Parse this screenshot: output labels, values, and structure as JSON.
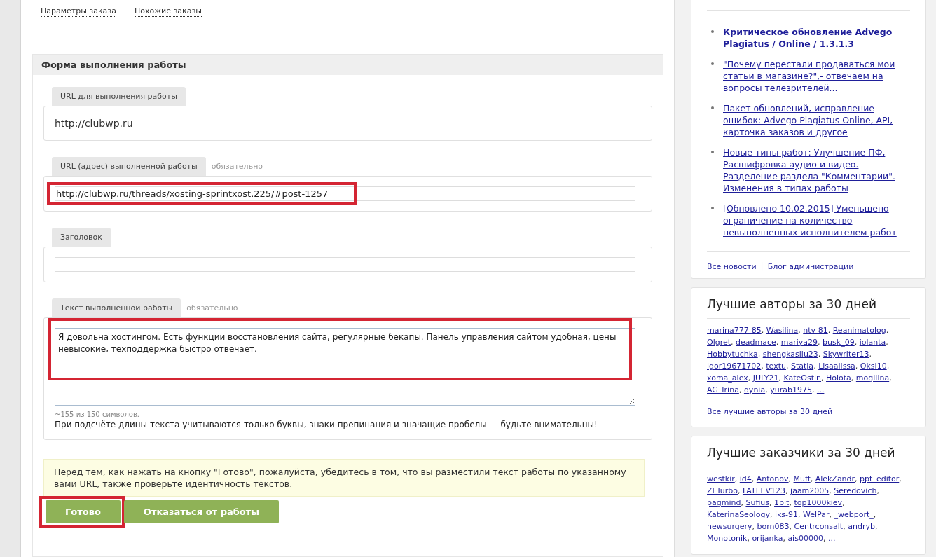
{
  "tabs": [
    {
      "label": "Параметры заказа"
    },
    {
      "label": "Похожие заказы"
    }
  ],
  "form": {
    "title": "Форма выполнения работы",
    "fields": [
      {
        "kind": "static",
        "label": "URL для выполнения работы",
        "value": "http://clubwp.ru",
        "highlighted": false
      },
      {
        "kind": "input",
        "label": "URL (адрес) выполненной работы",
        "required_note": "обязательно",
        "value": "http://clubwp.ru/threads/xosting-sprintxost.225/#post-1257",
        "highlighted": true
      },
      {
        "kind": "input",
        "label": "Заголовок",
        "highlighted": false
      },
      {
        "kind": "textarea",
        "label": "Текст выполненной работы",
        "required_note": "обязательно",
        "value": "Я довольна хостингом. Есть функции восстановления сайта, регулярные бекапы. Панель управления сайтом удобная, цены невысокие, техподдержка быстро отвечает.",
        "counter": "~155 из 150 символов.",
        "note": "При подсчёте длины текста учитываются только буквы, знаки препинания и значащие пробелы — будьте внимательны!",
        "highlighted": true
      }
    ],
    "notice": "Перед тем, как нажать на кнопку \"Готово\", пожалуйста, убедитесь в том, что вы разместили текст работы по указанному вами URL, также проверьте идентичность текстов.",
    "buttons": [
      {
        "label": "Готово",
        "highlighted": true
      },
      {
        "label": "Отказаться от работы",
        "highlighted": false
      }
    ]
  },
  "news": {
    "items": [
      {
        "text": "Критическое обновление Advego Plagiatus / Online / 1.3.1.3",
        "bold": true
      },
      {
        "text": "\"Почему перестали продаваться мои статьи в магазине?\",- отвечаем на вопросы телезрителей...",
        "bold": false
      },
      {
        "text": "Пакет обновлений, исправление ошибок: Advego Plagiatus Online, API, карточка заказов и другое",
        "bold": false
      },
      {
        "text": "Новые типы работ: Улучшение ПФ, Расшифровка аудио и видео. Разделение раздела \"Комментарии\". Изменения в типах работы",
        "bold": false
      },
      {
        "text": "[Обновлено 10.02.2015] Уменьшено ограничение на количество невыполненных исполнителем работ",
        "bold": false
      }
    ],
    "footer_links": [
      "Все новости",
      "Блог администрации"
    ],
    "footer_separator": "|"
  },
  "name_separator": ",",
  "top_authors": {
    "title": "Лучшие авторы за 30 дней",
    "names": [
      "marina777-85",
      "Wasilina",
      "ntv-81",
      "Reanimatolog",
      "Olgret",
      "deadmace",
      "mariya29",
      "busk_09",
      "iolanta",
      "Hobbytuchka",
      "shengkasilu23",
      "Skywriter13",
      "igor19671702",
      "textu",
      "Statja",
      "Lisaalissa",
      "Oksi10",
      "xoma_alex",
      "JULY21",
      "KateOstin",
      "Holota",
      "mogilina",
      "AG_Irina",
      "dynia",
      "yurab1975",
      "..."
    ],
    "all_link": "Все лучшие авторы за 30 дней"
  },
  "top_customers": {
    "title": "Лучшие заказчики за 30 дней",
    "names": [
      "westkir",
      "id4",
      "Antonov",
      "Muff",
      "AlekZandr",
      "ppt_editor",
      "ZFTurbo",
      "FATEEV123",
      "jaam2005",
      "Seredovich",
      "pagmind",
      "Sufius",
      "1bit",
      "top1000kiev",
      "KaterinaSeology",
      "iks-91",
      "WelPar",
      "_webport_",
      "newsurgery",
      "born083",
      "Centrconsalt",
      "andryb",
      "Monotonik",
      "orijanka",
      "ais00000",
      "..."
    ]
  }
}
